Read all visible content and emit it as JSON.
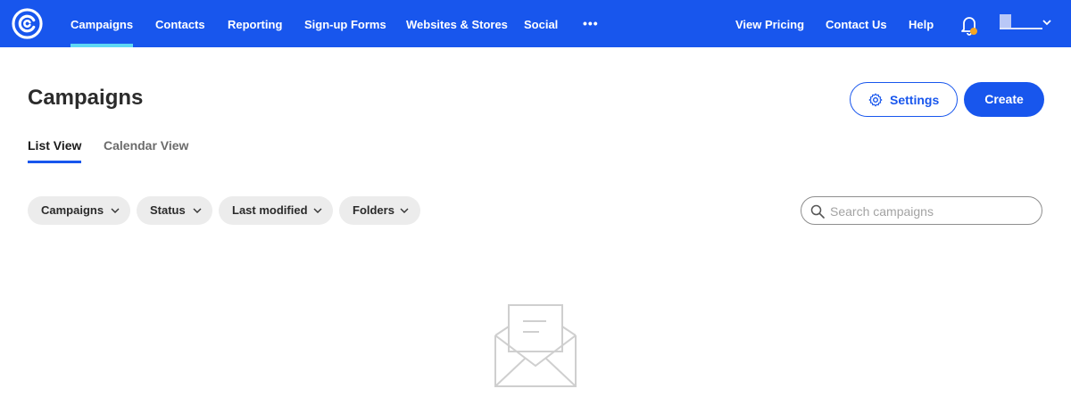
{
  "nav": {
    "items": [
      {
        "label": "Campaigns",
        "active": true
      },
      {
        "label": "Contacts"
      },
      {
        "label": "Reporting"
      },
      {
        "label": "Sign-up Forms"
      },
      {
        "label": "Websites & Stores"
      },
      {
        "label": "Social"
      }
    ],
    "more": "•••",
    "right": [
      {
        "label": "View Pricing"
      },
      {
        "label": "Contact Us"
      },
      {
        "label": "Help"
      }
    ],
    "notification_dot_color": "#f5a623",
    "bg_color": "#1856ed",
    "active_underline_color": "#5ed8f5"
  },
  "page": {
    "title": "Campaigns",
    "settings_label": "Settings",
    "create_label": "Create"
  },
  "tabs": [
    {
      "label": "List View",
      "active": true
    },
    {
      "label": "Calendar View"
    }
  ],
  "filters": [
    {
      "label": "Campaigns"
    },
    {
      "label": "Status"
    },
    {
      "label": "Last modified"
    },
    {
      "label": "Folders"
    }
  ],
  "search": {
    "placeholder": "Search campaigns",
    "value": ""
  },
  "icons": {
    "logo": "constant-contact-logo",
    "bell": "bell-icon",
    "gear": "gear-icon",
    "search": "search-icon",
    "empty": "envelope-letter-icon"
  }
}
